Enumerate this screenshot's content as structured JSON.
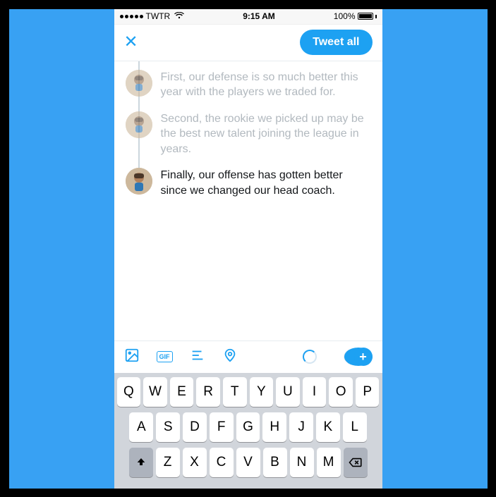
{
  "status": {
    "carrier": "TWTR",
    "time": "9:15 AM",
    "battery_pct": "100%"
  },
  "nav": {
    "close_label": "✕",
    "tweet_all_label": "Tweet all"
  },
  "thread": {
    "entries": [
      {
        "text": "First, our defense is so much better this year with the players we traded for.",
        "active": false
      },
      {
        "text": "Second, the rookie we picked up may be the best new talent joining the league in years.",
        "active": false
      },
      {
        "text": "Finally, our offense has gotten better since we changed our head coach.",
        "active": true
      }
    ]
  },
  "toolbar": {
    "photo_icon": "photo-icon",
    "gif_label": "GIF",
    "poll_icon": "poll-icon",
    "location_icon": "location-icon",
    "char_ring": "char-count-ring",
    "add_label": "+"
  },
  "keyboard": {
    "row1": [
      "Q",
      "W",
      "E",
      "R",
      "T",
      "Y",
      "U",
      "I",
      "O",
      "P"
    ],
    "row2": [
      "A",
      "S",
      "D",
      "F",
      "G",
      "H",
      "J",
      "K",
      "L"
    ],
    "row3": [
      "Z",
      "X",
      "C",
      "V",
      "B",
      "N",
      "M"
    ]
  },
  "colors": {
    "accent": "#1da1f2",
    "frame": "#38a1f3"
  }
}
